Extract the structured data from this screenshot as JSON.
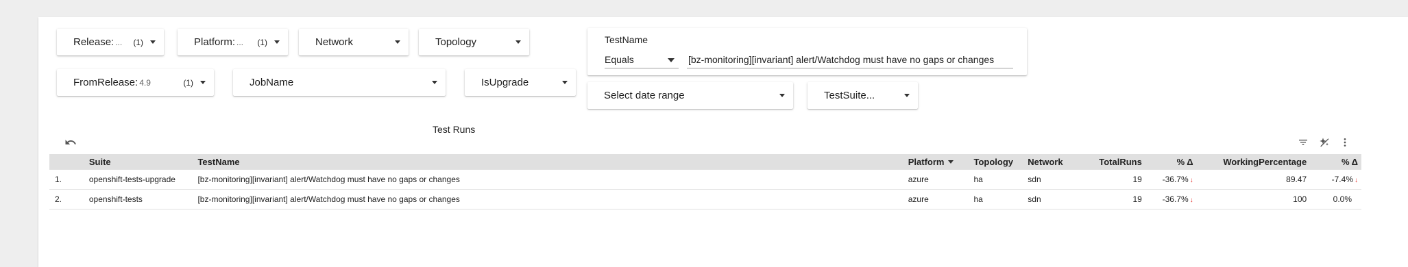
{
  "filters": {
    "release": {
      "label": "Release:",
      "value": "...",
      "count": "(1)"
    },
    "platform": {
      "label": "Platform:",
      "value": "...",
      "count": "(1)"
    },
    "network": {
      "label": "Network"
    },
    "topology": {
      "label": "Topology"
    },
    "from_release": {
      "label": "FromRelease:",
      "value": "4.9",
      "count": "(1)"
    },
    "job_name": {
      "label": "JobName"
    },
    "is_upgrade": {
      "label": "IsUpgrade"
    },
    "test_name": {
      "title": "TestName",
      "operator": "Equals",
      "value": "[bz-monitoring][invariant] alert/Watchdog must have no gaps or changes"
    },
    "date_range": {
      "label": "Select date range"
    },
    "test_suite": {
      "label": "TestSuite..."
    }
  },
  "table": {
    "title": "Test Runs",
    "columns": [
      "Suite",
      "TestName",
      "Platform",
      "Topology",
      "Network",
      "TotalRuns",
      "% Δ",
      "WorkingPercentage",
      "% Δ"
    ],
    "rows": [
      {
        "idx": "1.",
        "suite": "openshift-tests-upgrade",
        "test": "[bz-monitoring][invariant] alert/Watchdog must have no gaps or changes",
        "platform": "azure",
        "topology": "ha",
        "network": "sdn",
        "total_runs": "19",
        "pct_delta_runs": "-36.7%",
        "working_pct": "89.47",
        "pct_delta_working": "-7.4%"
      },
      {
        "idx": "2.",
        "suite": "openshift-tests",
        "test": "[bz-monitoring][invariant] alert/Watchdog must have no gaps or changes",
        "platform": "azure",
        "topology": "ha",
        "network": "sdn",
        "total_runs": "19",
        "pct_delta_runs": "-36.7%",
        "working_pct": "100",
        "pct_delta_working": "0.0%"
      }
    ]
  },
  "icons": {
    "undo": "undo-icon",
    "filter": "filter-icon",
    "ai": "ai-sparkle-icon",
    "menu": "more-vert-icon",
    "down_arrow": "arrow-down-icon"
  },
  "colors": {
    "down_arrow": "#e53935",
    "header_bg": "#e0e0e0"
  }
}
